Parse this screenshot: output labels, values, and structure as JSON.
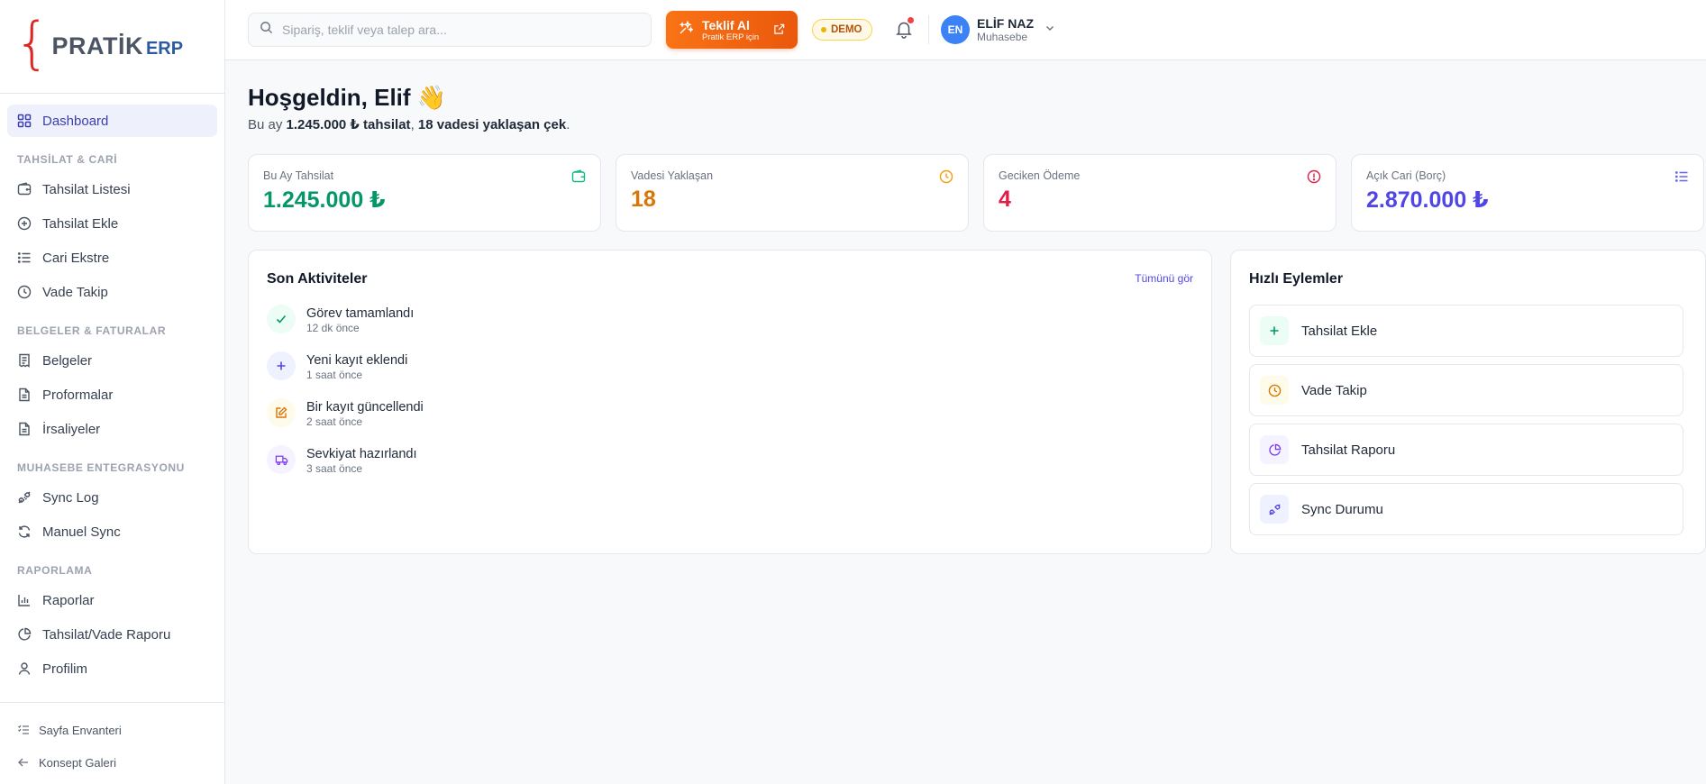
{
  "brand": {
    "brace": "{",
    "name": "PRATİK",
    "suffix": "ERP"
  },
  "sidebar": {
    "dashboard": "Dashboard",
    "sections": [
      {
        "title": "TAHSİLAT & CARİ",
        "items": [
          "Tahsilat Listesi",
          "Tahsilat Ekle",
          "Cari Ekstre",
          "Vade Takip"
        ]
      },
      {
        "title": "BELGELER & FATURALAR",
        "items": [
          "Belgeler",
          "Proformalar",
          "İrsaliyeler"
        ]
      },
      {
        "title": "MUHASEBE ENTEGRASYONU",
        "items": [
          "Sync Log",
          "Manuel Sync"
        ]
      },
      {
        "title": "RAPORLAMA",
        "items": [
          "Raporlar",
          "Tahsilat/Vade Raporu",
          "Profilim"
        ]
      }
    ],
    "footer": [
      "Sayfa Envanteri",
      "Konsept Galeri"
    ]
  },
  "topbar": {
    "search_placeholder": "Sipariş, teklif veya talep ara...",
    "teklif_title": "Teklif Al",
    "teklif_sub": "Pratik ERP için",
    "demo": "DEMO",
    "user_initials": "EN",
    "user_name": "ELİF NAZ",
    "user_role": "Muhasebe"
  },
  "welcome": {
    "title": "Hoşgeldin, Elif 👋",
    "sub_prefix": "Bu ay ",
    "sub_amount": "1.245.000 ₺ tahsilat",
    "sub_mid": ", ",
    "sub_count": "18 vadesi yaklaşan çek",
    "sub_suffix": "."
  },
  "stats": [
    {
      "label": "Bu Ay Tahsilat",
      "value": "1.245.000 ₺",
      "color": "#059669"
    },
    {
      "label": "Vadesi Yaklaşan",
      "value": "18",
      "color": "#d97706"
    },
    {
      "label": "Geciken Ödeme",
      "value": "4",
      "color": "#e11d48"
    },
    {
      "label": "Açık Cari (Borç)",
      "value": "2.870.000 ₺",
      "color": "#4f46e5"
    }
  ],
  "activities": {
    "title": "Son Aktiviteler",
    "see_all": "Tümünü gör",
    "items": [
      {
        "title": "Görev tamamlandı",
        "time": "12 dk önce",
        "icon": "check-icon"
      },
      {
        "title": "Yeni kayıt eklendi",
        "time": "1 saat önce",
        "icon": "plus-icon"
      },
      {
        "title": "Bir kayıt güncellendi",
        "time": "2 saat önce",
        "icon": "edit-icon"
      },
      {
        "title": "Sevkiyat hazırlandı",
        "time": "3 saat önce",
        "icon": "truck-icon"
      }
    ]
  },
  "quick": {
    "title": "Hızlı Eylemler",
    "items": [
      {
        "label": "Tahsilat Ekle",
        "icon": "plus-icon"
      },
      {
        "label": "Vade Takip",
        "icon": "clock-icon"
      },
      {
        "label": "Tahsilat Raporu",
        "icon": "pie-chart-icon"
      },
      {
        "label": "Sync Durumu",
        "icon": "plug-icon"
      }
    ]
  }
}
